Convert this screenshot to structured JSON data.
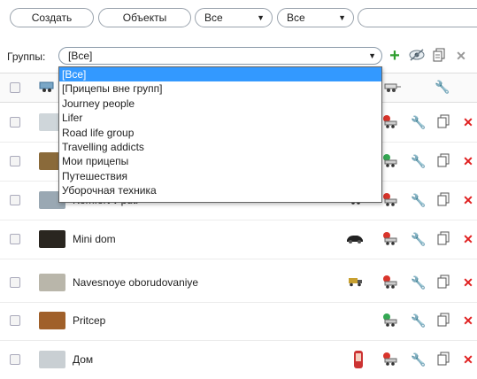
{
  "toolbar": {
    "create_label": "Создать",
    "objects_label": "Объекты",
    "filter1_value": "Все",
    "filter2_value": "Все"
  },
  "groups": {
    "label": "Группы:",
    "selected": "[Все]",
    "options": [
      "[Все]",
      "[Прицепы вне групп]",
      "Journey people",
      "Lifer",
      "Road life group",
      "Travelling addicts",
      "Мои прицепы",
      "Путешествия",
      "Уборочная техника"
    ]
  },
  "rows": [
    {
      "name": ""
    },
    {
      "name": ""
    },
    {
      "name": "Komfort v puti"
    },
    {
      "name": "Mini dom"
    },
    {
      "name": "Navesnoye oborudovaniye"
    },
    {
      "name": "Pritcep"
    },
    {
      "name": "Дом"
    }
  ],
  "icons": {
    "add": "plus-icon",
    "visibility": "eye-icon",
    "copy": "copy-icon",
    "close": "close-icon",
    "wrench": "wrench-icon",
    "trailer": "trailer-icon",
    "delete": "delete-icon"
  },
  "colors": {
    "add_green": "#2e9e2e",
    "delete_red": "#e02020",
    "selected_blue": "#3399ff",
    "status_red": "#d9342b",
    "status_green": "#34a853"
  }
}
